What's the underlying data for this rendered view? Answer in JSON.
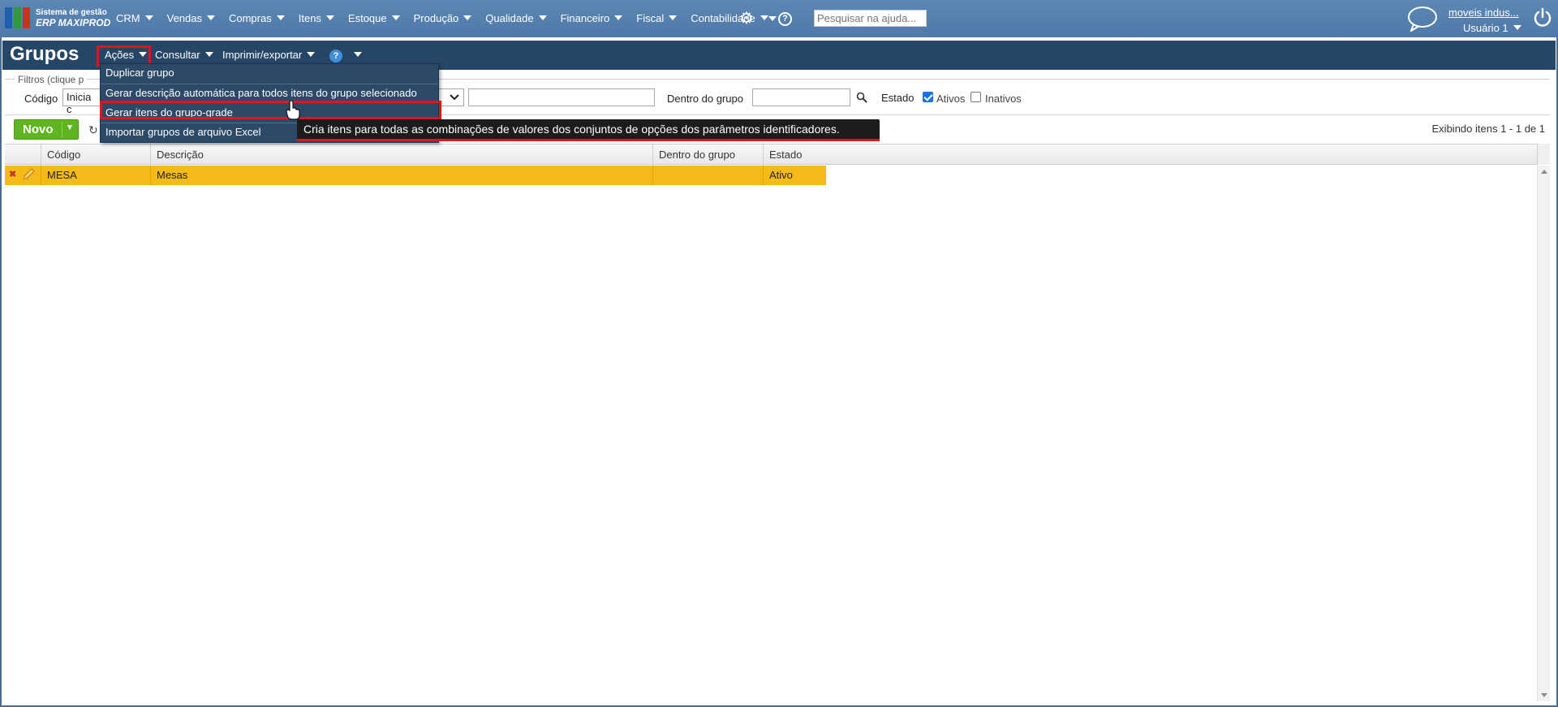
{
  "topnav": {
    "logo_line1": "Sistema de gestão",
    "logo_line2": "ERP MAXIPROD",
    "menu": [
      "CRM",
      "Vendas",
      "Compras",
      "Itens",
      "Estoque",
      "Produção",
      "Qualidade",
      "Financeiro",
      "Fiscal",
      "Contabilidade"
    ],
    "help_icon_text": "?",
    "search_placeholder": "Pesquisar na ajuda...",
    "company": "moveis indus...",
    "user": "Usuário 1"
  },
  "page": {
    "title": "Grupos",
    "menu": {
      "acoes": "Ações",
      "consultar": "Consultar",
      "imprimir": "Imprimir/exportar",
      "help": "?"
    }
  },
  "actions_dropdown": {
    "items": [
      "Duplicar grupo",
      "Gerar descrição automática para todos itens do grupo selecionado",
      "Gerar itens do grupo-grade",
      "Importar grupos de arquivo Excel"
    ],
    "tooltip": "Cria itens para todas as combinações de valores dos conjuntos de opções dos parâmetros identificadores."
  },
  "filters": {
    "legend": "Filtros (clique p",
    "codigo_label": "Código",
    "codigo_mode": "Inicia c",
    "descricao_value": "",
    "dentro_label": "Dentro do grupo",
    "dentro_value": "",
    "estado_label": "Estado",
    "ativos_label": "Ativos",
    "ativos_checked": true,
    "inativos_label": "Inativos",
    "inativos_checked": false
  },
  "toolbar": {
    "novo_label": "Novo",
    "counter": "Exibindo itens 1 - 1 de 1"
  },
  "grid": {
    "columns": [
      "Código",
      "Descrição",
      "Dentro do grupo",
      "Estado"
    ],
    "rows": [
      {
        "codigo": "MESA",
        "descricao": "Mesas",
        "dentro": "",
        "estado": "Ativo"
      }
    ]
  },
  "colors": {
    "topbar": "#5d87b5",
    "pagebar": "#264668",
    "dropdown": "#2c4a68",
    "selected_row": "#f3ba19",
    "novo_button": "#5fb51f",
    "highlight": "#e0141b"
  }
}
